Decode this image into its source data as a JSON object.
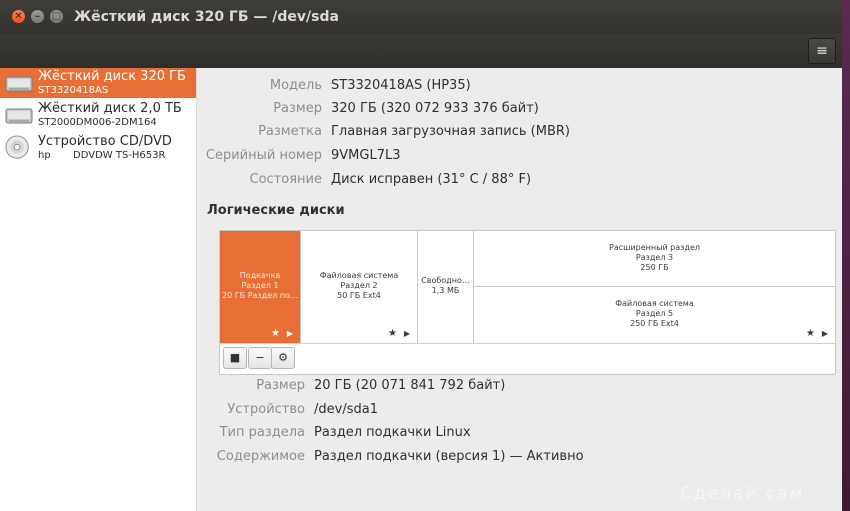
{
  "window": {
    "title": "Жёсткий диск 320 ГБ — /dev/sda",
    "close_glyph": "✕",
    "min_glyph": "–",
    "max_glyph": "□",
    "menu_glyph": "≡"
  },
  "sidebar": {
    "drives": [
      {
        "name": "Жёсткий диск 320 ГБ",
        "sub": "ST3320418AS",
        "icon": "hard-disk-icon",
        "selected": true
      },
      {
        "name": "Жёсткий диск 2,0 ТБ",
        "sub": "ST2000DM006-2DM164",
        "icon": "hard-disk-icon",
        "selected": false
      },
      {
        "name": "Устройство CD/DVD",
        "sub": "hp",
        "sub2": "DDVDW TS-H653R",
        "icon": "optical-disc-icon",
        "selected": false
      }
    ]
  },
  "disk_info": {
    "model_label": "Модель",
    "model_value": "ST3320418AS (HP35)",
    "size_label": "Размер",
    "size_value": "320 ГБ (320 072 933 376 байт)",
    "partitioning_label": "Разметка",
    "partitioning_value": "Главная загрузочная запись (MBR)",
    "serial_label": "Серийный номер",
    "serial_value": "9VMGL7L3",
    "state_label": "Состояние",
    "state_value": "Диск исправен (31° C / 88° F)"
  },
  "volumes": {
    "title": "Логические диски",
    "segments": {
      "swap": {
        "line1": "Подкачка",
        "line2": "Раздел 1",
        "line3": "20 ГБ Раздел по…"
      },
      "fs2": {
        "line1": "Файловая система",
        "line2": "Раздел 2",
        "line3": "50 ГБ Ext4"
      },
      "free": {
        "line1": "Свободно…",
        "line2": "1,3 МБ"
      },
      "extended": {
        "line1": "Расширенный раздел",
        "line2": "Раздел 3",
        "line3": "250 ГБ"
      },
      "fs5": {
        "line1": "Файловая система",
        "line2": "Раздел 5",
        "line3": "250 ГБ Ext4"
      }
    },
    "star": "★",
    "arrow": "▶",
    "tools": {
      "stop": "■",
      "remove": "−",
      "settings": "⚙"
    }
  },
  "partition_info": {
    "size_label": "Размер",
    "size_value": "20 ГБ (20 071 841 792 байт)",
    "device_label": "Устройство",
    "device_value": "/dev/sda1",
    "type_label": "Тип раздела",
    "type_value": "Раздел подкачки Linux",
    "contents_label": "Содержимое",
    "contents_value": "Раздел подкачки (версия 1) — Активно"
  },
  "watermark": "Сделай сам",
  "colors": {
    "accent": "#e76f35",
    "titlebar": "#3c3b37"
  }
}
